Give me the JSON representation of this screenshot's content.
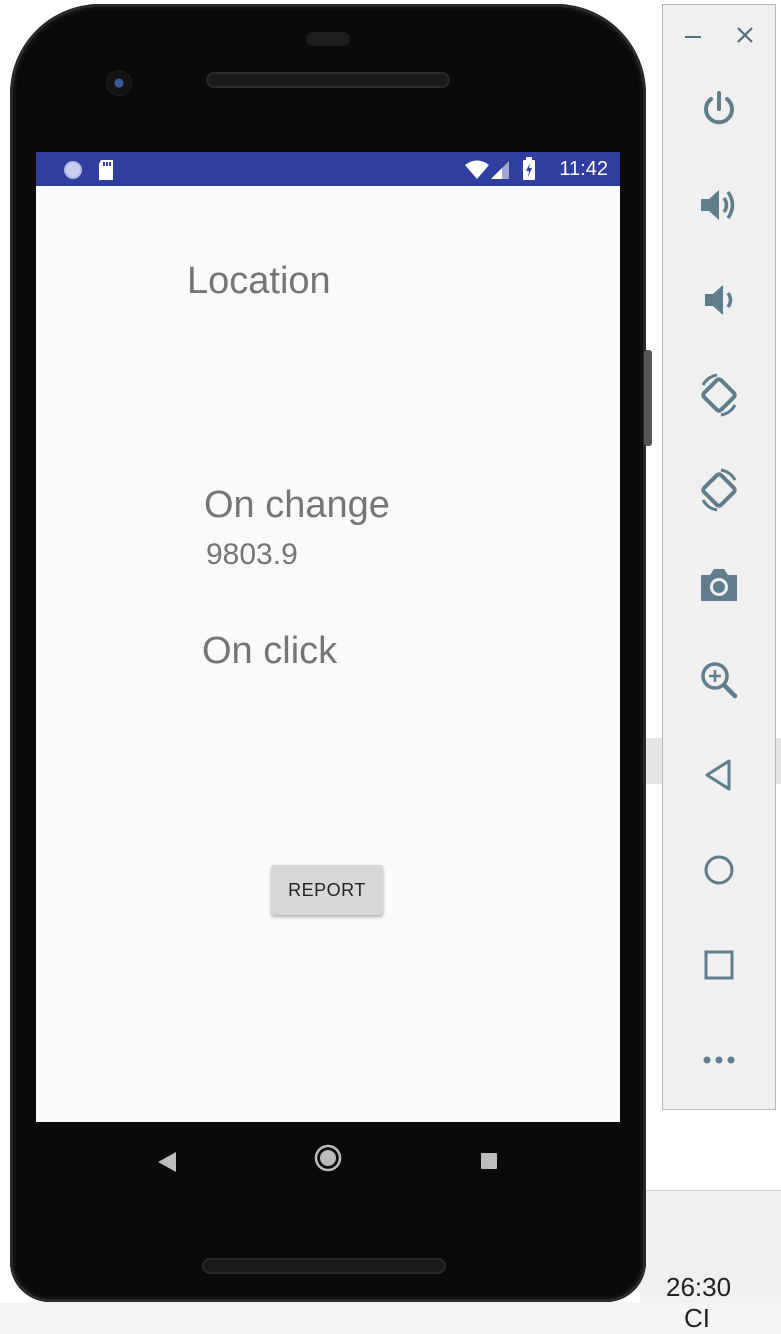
{
  "app": {
    "title": "Location",
    "on_change_label": "On change",
    "on_change_value": "9803.9",
    "on_click_label": "On click",
    "report_button": "REPORT"
  },
  "status_bar": {
    "time": "11:42",
    "color": "#303f9f"
  },
  "ide": {
    "status_time": "26:30",
    "status_extra": "CI"
  },
  "emulator_sidebar": {
    "buttons": [
      "minimize-icon",
      "close-icon",
      "power-icon",
      "volume-up-icon",
      "volume-down-icon",
      "rotate-left-icon",
      "rotate-right-icon",
      "camera-icon",
      "zoom-icon",
      "back-icon",
      "home-icon",
      "overview-icon",
      "more-icon"
    ]
  },
  "colors": {
    "accent": "#303f9f",
    "icon": "#607d8b",
    "text": "#757575",
    "button_bg": "#d6d7d7"
  }
}
